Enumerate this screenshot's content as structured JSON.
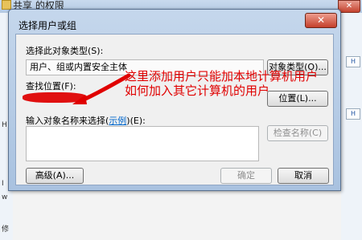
{
  "background": {
    "title": "共享 的权限",
    "left_letters": [
      "H",
      "I",
      "w",
      "修"
    ],
    "right_label": "H"
  },
  "dialog": {
    "title": "选择用户或组",
    "close_icon": "close-icon",
    "object_type_label": "选择此对象类型(S):",
    "object_type_value": "用户、组或内置安全主体",
    "object_type_button": "对象类型(O)...",
    "location_label": "查找位置(F):",
    "location_button": "位置(L)...",
    "names_label_prefix": "输入对象名称来选择(",
    "names_label_link": "示例",
    "names_label_suffix": ")(E):",
    "names_value": "",
    "check_names_button": "检查名称(C)",
    "advanced_button": "高级(A)...",
    "ok_button": "确定",
    "cancel_button": "取消"
  },
  "annotation": {
    "line1": "这里添加用户只能加本地计算机用户",
    "line2": "如何加入其它计算机的用户",
    "color": "#e00000"
  }
}
